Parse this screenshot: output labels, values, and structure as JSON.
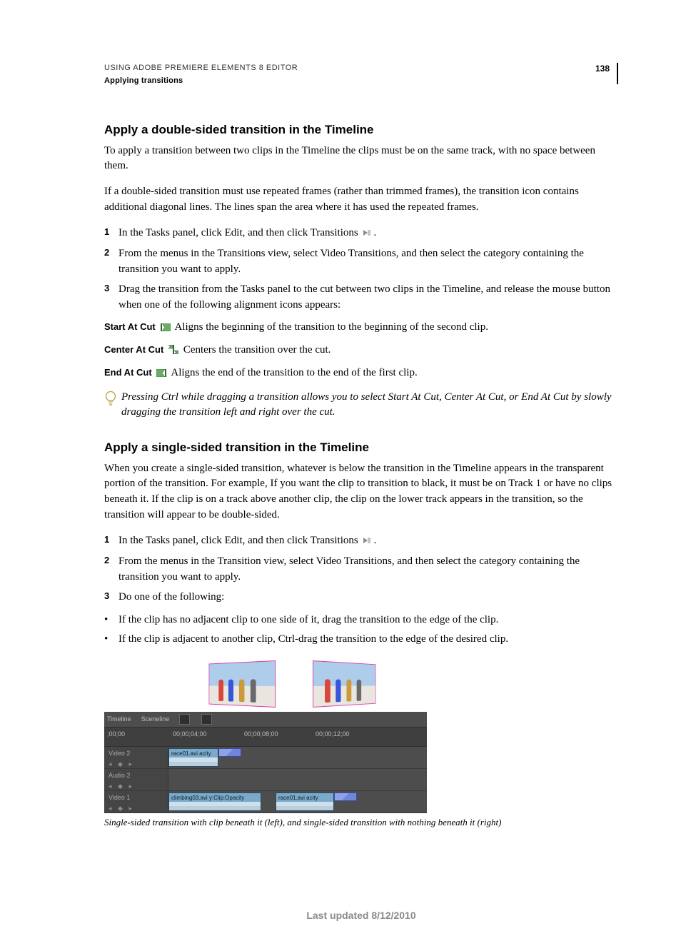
{
  "header": {
    "title": "USING ADOBE PREMIERE ELEMENTS 8 EDITOR",
    "section": "Applying transitions",
    "page_number": "138"
  },
  "section1": {
    "heading": "Apply a double-sided transition in the Timeline",
    "p1": "To apply a transition between two clips in the Timeline the clips must be on the same track, with no space between them.",
    "p2": "If a double-sided transition must use repeated frames (rather than trimmed frames), the transition icon contains additional diagonal lines. The lines span the area where it has used the repeated frames.",
    "steps": [
      "In the Tasks panel, click Edit, and then click Transitions ",
      "From the menus in the Transitions view, select Video Transitions, and then select the category containing the transition you want to apply.",
      "Drag the transition from the Tasks panel to the cut between two clips in the Timeline, and release the mouse button when one of the following alignment icons appears:"
    ],
    "defs": {
      "start_term": "Start At Cut",
      "start_txt": "  Aligns the beginning of the transition to the beginning of the second clip.",
      "center_term": "Center At Cut",
      "center_txt": "  Centers the transition over the cut.",
      "end_term": "End At Cut",
      "end_txt": "  Aligns the end of the transition to the end of the first clip."
    },
    "tip": "Pressing Ctrl while dragging a transition allows you to select Start At Cut, Center At Cut, or End At Cut by slowly dragging the transition left and right over the cut."
  },
  "section2": {
    "heading": "Apply a single-sided transition in the Timeline",
    "p1": "When you create a single-sided transition, whatever is below the transition in the Timeline appears in the transparent portion of the transition. For example, If you want the clip to transition to black, it must be on Track 1 or have no clips beneath it. If the clip is on a track above another clip, the clip on the lower track appears in the transition, so the transition will appear to be double-sided.",
    "steps": [
      "In the Tasks panel, click Edit, and then click Transitions ",
      "From the menus in the Transition view, select Video Transitions, and then select the category containing the transition you want to apply.",
      "Do one of the following:"
    ],
    "bullets": [
      "If the clip has no adjacent clip to one side of it, drag the transition to the edge of the clip.",
      "If the clip is adjacent to another clip, Ctrl-drag the transition to the edge of the desired clip."
    ],
    "caption": "Single-sided transition with clip beneath it (left), and single-sided transition with nothing beneath it (right)"
  },
  "figure": {
    "tab1": "Timeline",
    "tab2": "Sceneline",
    "tc0": ";00;00",
    "tc1": "00;00;04;00",
    "tc2": "00;00;08;00",
    "tc3": "00;00;12;00",
    "track_v2": "Video 2",
    "track_a2": "Audio 2",
    "track_v1": "Video 1",
    "clip_v2": "race01.avi acity",
    "clip_v1a": "climbing03.avi y:Clip:Opacity",
    "clip_v1b": "race01.avi acity"
  },
  "footer": "Last updated 8/12/2010"
}
